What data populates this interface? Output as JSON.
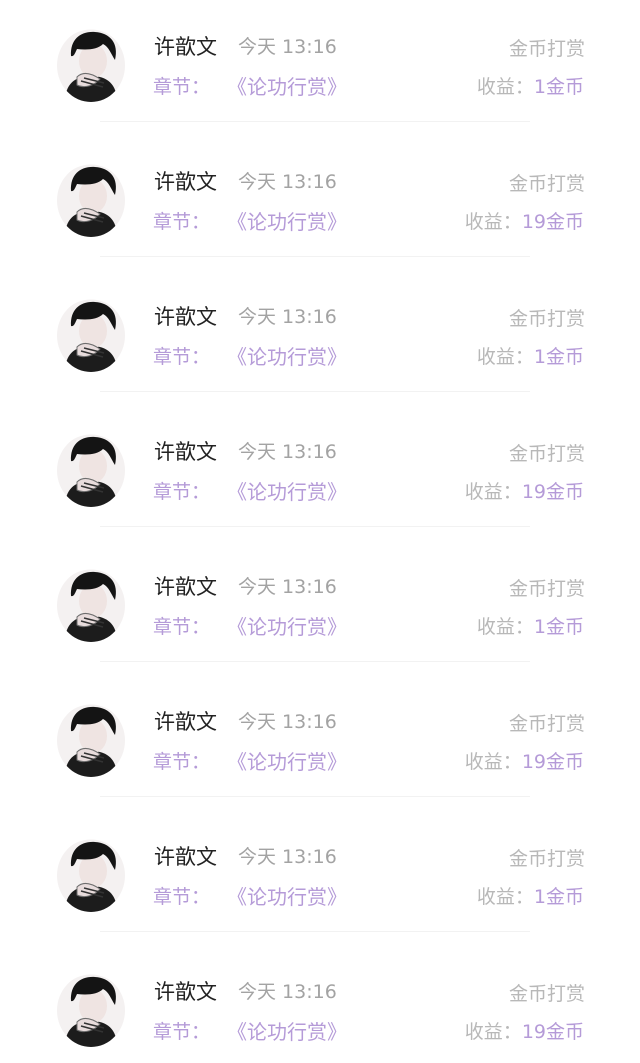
{
  "colors": {
    "accent": "#b59bd8",
    "name": "#222222",
    "muted": "#b8b8b8",
    "time": "#a3a3a3",
    "divider": "#f2f2f2"
  },
  "records": [
    {
      "avatar_icon": "user-avatar-icon",
      "name": "许歆文",
      "time": "今天 13:16",
      "type": "金币打赏",
      "chapter_label": "章节：",
      "chapter_title": "《论功行赏》",
      "income_label": "收益：",
      "income_value": "1金币"
    },
    {
      "avatar_icon": "user-avatar-icon",
      "name": "许歆文",
      "time": "今天 13:16",
      "type": "金币打赏",
      "chapter_label": "章节：",
      "chapter_title": "《论功行赏》",
      "income_label": "收益：",
      "income_value": "19金币"
    },
    {
      "avatar_icon": "user-avatar-icon",
      "name": "许歆文",
      "time": "今天 13:16",
      "type": "金币打赏",
      "chapter_label": "章节：",
      "chapter_title": "《论功行赏》",
      "income_label": "收益：",
      "income_value": "1金币"
    },
    {
      "avatar_icon": "user-avatar-icon",
      "name": "许歆文",
      "time": "今天 13:16",
      "type": "金币打赏",
      "chapter_label": "章节：",
      "chapter_title": "《论功行赏》",
      "income_label": "收益：",
      "income_value": "19金币"
    },
    {
      "avatar_icon": "user-avatar-icon",
      "name": "许歆文",
      "time": "今天 13:16",
      "type": "金币打赏",
      "chapter_label": "章节：",
      "chapter_title": "《论功行赏》",
      "income_label": "收益：",
      "income_value": "1金币"
    },
    {
      "avatar_icon": "user-avatar-icon",
      "name": "许歆文",
      "time": "今天 13:16",
      "type": "金币打赏",
      "chapter_label": "章节：",
      "chapter_title": "《论功行赏》",
      "income_label": "收益：",
      "income_value": "19金币"
    },
    {
      "avatar_icon": "user-avatar-icon",
      "name": "许歆文",
      "time": "今天 13:16",
      "type": "金币打赏",
      "chapter_label": "章节：",
      "chapter_title": "《论功行赏》",
      "income_label": "收益：",
      "income_value": "1金币"
    },
    {
      "avatar_icon": "user-avatar-icon",
      "name": "许歆文",
      "time": "今天 13:16",
      "type": "金币打赏",
      "chapter_label": "章节：",
      "chapter_title": "《论功行赏》",
      "income_label": "收益：",
      "income_value": "19金币"
    }
  ]
}
